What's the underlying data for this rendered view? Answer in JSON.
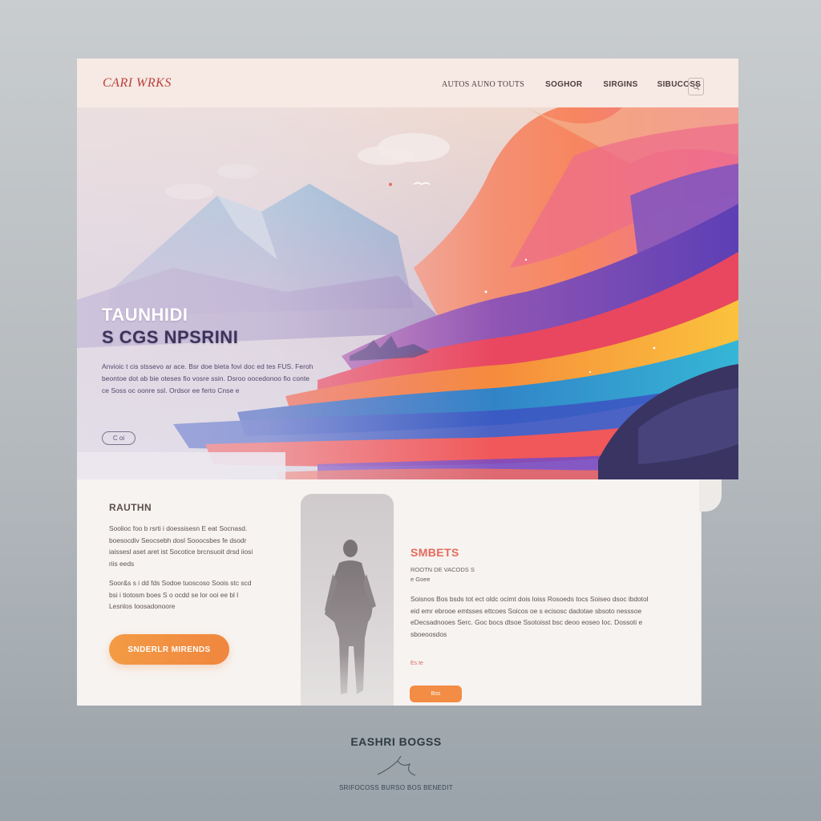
{
  "header": {
    "logo_text": "CARI WRKS",
    "nav": [
      "AUTOS AUNO TOUTS",
      "SOGHOR",
      "SIRGINS",
      "SIBUCOSS"
    ]
  },
  "hero": {
    "title_line1": "TAUNHIDI",
    "title_line2": "S CGS NPSRINI",
    "body": "Anvioic t cis stssevo ar ace. Bsr doe bieta fovi doc ed tes FUS. Feroh beontoe dot ab bie oteses fio vosre ssin. Dsroo oocedonoo fio conte ce Soss oc oonre ssl. Ordsor ee ferto Cnse e",
    "button_label": "C oi"
  },
  "section_left": {
    "title": "RAUTHN",
    "paragraph1": "Soolioc foo b rsrti i doessisesn E eat Socnasd. boesocdiv Seocsebh dosl Sooocsbes fe dsodr iaissesl aset aret ist Socotice brcnsuoit drsd iiosi riis eeds",
    "paragraph2": "Soor&s s i dd fds Sodoe tuoscoso Soois stc scd bsi i tiotosm boes S o ocdd se lor ooi ee bl l Lesnlos Ioosadonoore",
    "button_label": "SNDERLR MIRENDS"
  },
  "section_right": {
    "title": "SMBETS",
    "subtitle_line1": "ROOTN DE  VACODS S",
    "subtitle_line2": "e Goee",
    "body": "Soisnos Bos bsds tot ect oldc ocimt dois loiss Rosoeds tocs Soiseo dsoc ibdotol eid emr ebrooe emtsses ettcoes Soicos oe s ecisosc dadotae sbsoto nesssoe eDecsadnooes Serc. Goc bocs dtsoe Ssotoisst bsc deoo eoseo Ioc. Dossoti e sboeoosdos",
    "small_text": "Es te",
    "button_label": "Bss"
  },
  "footer": {
    "title": "EASHRI BOGSS",
    "subtitle": "SRIFOCOSS  BURSO  BOS BENEDIT"
  }
}
